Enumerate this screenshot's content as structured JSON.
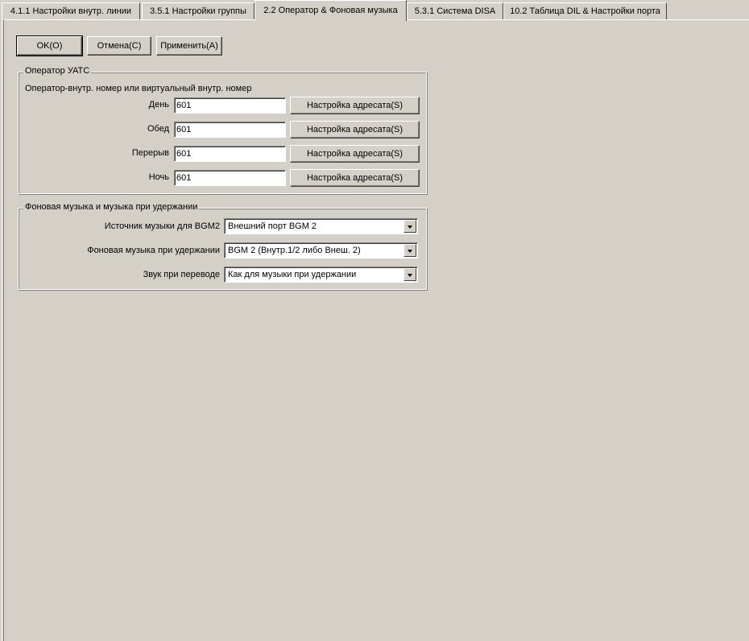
{
  "tabs": [
    {
      "label": "4.1.1 Настройки внутр. линии"
    },
    {
      "label": "3.5.1 Настройки группы"
    },
    {
      "label": "2.2 Оператор & Фоновая музыка"
    },
    {
      "label": "5.3.1 Система DISA"
    },
    {
      "label": "10.2 Таблица DIL & Настройки порта"
    }
  ],
  "buttons": {
    "ok": "OK(O)",
    "cancel": "Отмена(C)",
    "apply": "Применить(A)"
  },
  "operator": {
    "title": "Оператор УАТС",
    "subtitle": "Оператор-внутр. номер или виртуальный внутр. номер",
    "rows": [
      {
        "label": "День",
        "value": "601",
        "button": "Настройка адресата(S)"
      },
      {
        "label": "Обед",
        "value": "601",
        "button": "Настройка адресата(S)"
      },
      {
        "label": "Перерыв",
        "value": "601",
        "button": "Настройка адресата(S)"
      },
      {
        "label": "Ночь",
        "value": "601",
        "button": "Настройка адресата(S)"
      }
    ]
  },
  "music": {
    "title": "Фоновая музыка и музыка при удержании",
    "rows": [
      {
        "label": "Источник музыки для BGM2",
        "value": "Внешний порт BGM 2"
      },
      {
        "label": "Фоновая музыка при удержании",
        "value": "BGM 2 (Внутр.1/2 либо Внеш. 2)"
      },
      {
        "label": "Звук при переводе",
        "value": "Как для музыки при удержании"
      }
    ]
  },
  "colors": {
    "face": "#d4d0c8",
    "highlight": "#ffffff",
    "shadow": "#808080",
    "dark_shadow": "#404040"
  }
}
